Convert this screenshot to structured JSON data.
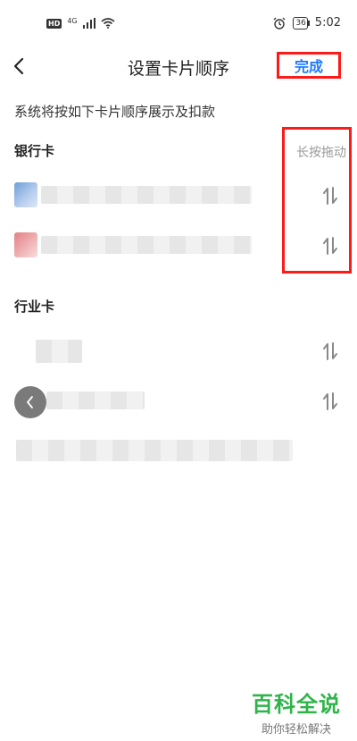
{
  "status_bar": {
    "hd_label": "HD",
    "network_label": "4G",
    "battery_level": "36",
    "time": "5:02"
  },
  "header": {
    "title": "设置卡片顺序",
    "done_label": "完成"
  },
  "description": "系统将按如下卡片顺序展示及扣款",
  "sections": {
    "bank_title": "银行卡",
    "bank_hint": "长按拖动",
    "industry_title": "行业卡"
  },
  "colors": {
    "accent": "#1e78ff",
    "highlight_red": "#ff1a1a",
    "watermark_green": "#2fb44a"
  },
  "watermark": {
    "main": "百科全说",
    "sub": "助你轻松解决"
  }
}
